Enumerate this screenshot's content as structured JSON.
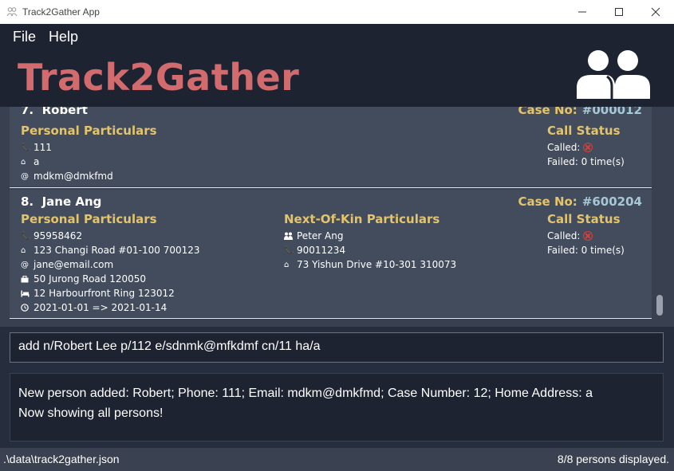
{
  "window": {
    "title": "Track2Gather App",
    "controls": [
      "minimize",
      "maximize",
      "close"
    ]
  },
  "menu": [
    "File",
    "Help"
  ],
  "brand": {
    "title": "Track2Gather",
    "icon": "people-icon"
  },
  "persons": [
    {
      "index": "7.",
      "name": "Robert",
      "case_label": "Case No:",
      "case_no": "#000012",
      "personal_title": "Personal Particulars",
      "phone": "111",
      "home": "a",
      "email": "mdkm@dmkfmd",
      "call_status_title": "Call Status",
      "called_label": "Called:",
      "failed": "Failed: 0 time(s)"
    },
    {
      "index": "8.",
      "name": "Jane Ang",
      "case_label": "Case No:",
      "case_no": "#600204",
      "personal_title": "Personal Particulars",
      "phone": "95958462",
      "home": "123 Changi Road #01-100 700123",
      "email": "jane@email.com",
      "work": "50 Jurong Road 120050",
      "quarantine": "12 Harbourfront Ring 123012",
      "shn_period": "2021-01-01 => 2021-01-14",
      "nok_title": "Next-Of-Kin Particulars",
      "nok_name": "Peter Ang",
      "nok_phone": "90011234",
      "nok_address": "73 Yishun Drive #10-301 310073",
      "call_status_title": "Call Status",
      "called_label": "Called:",
      "failed": "Failed: 0 time(s)"
    }
  ],
  "command": {
    "value": "add n/Robert Lee p/112 e/sdnmk@mfkdmf cn/11 ha/a"
  },
  "result": {
    "line1": "New person added: Robert; Phone: 111; Email: mdkm@dmkfmd; Case Number: 12; Home Address: a",
    "line2": "Now showing all persons!"
  },
  "status": {
    "file_path": ".\\data\\track2gather.json",
    "count": "8/8 persons displayed."
  },
  "colors": {
    "brand": "#d26b6d",
    "section_title": "#e4c46b",
    "case_number": "#a6c8d6",
    "card_bg": "#434c5d",
    "called_x": "#d8403a"
  }
}
